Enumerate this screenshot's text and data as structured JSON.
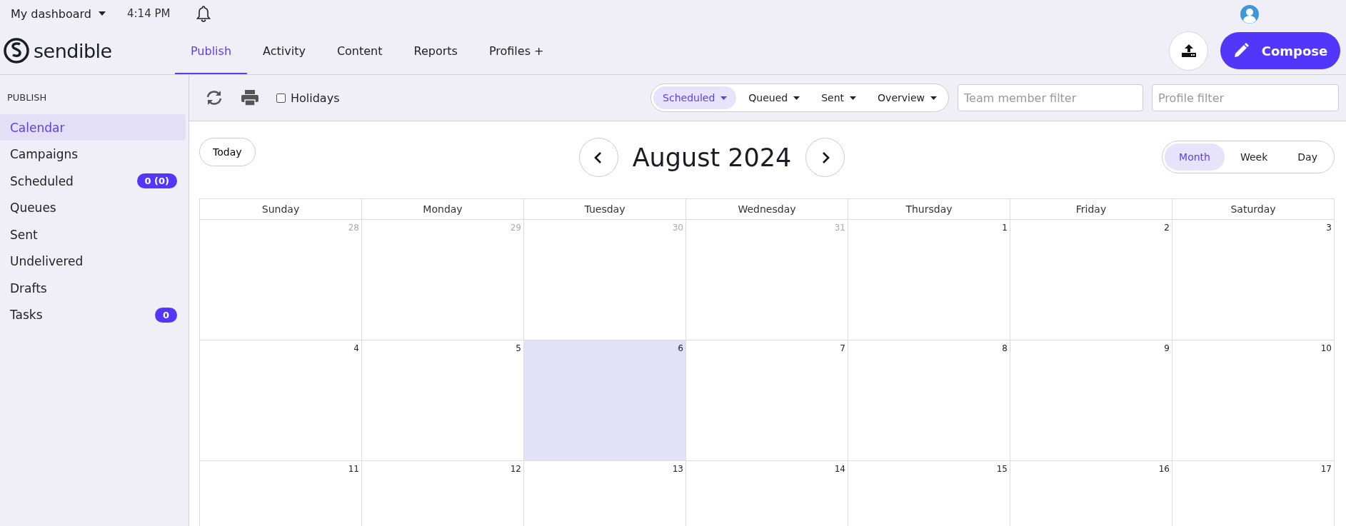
{
  "top_bar": {
    "dashboard": "My dashboard",
    "time": "4:14 PM"
  },
  "brand": "sendible",
  "nav_tabs": [
    {
      "label": "Publish",
      "selected": true
    },
    {
      "label": "Activity",
      "selected": false
    },
    {
      "label": "Content",
      "selected": false
    },
    {
      "label": "Reports",
      "selected": false
    },
    {
      "label": "Profiles +",
      "selected": false
    }
  ],
  "compose_button": "Compose",
  "sidebar": {
    "heading": "PUBLISH",
    "items": [
      {
        "label": "Calendar",
        "selected": true
      },
      {
        "label": "Campaigns",
        "selected": false
      },
      {
        "label": "Scheduled",
        "selected": false,
        "badge": "0 (0)"
      },
      {
        "label": "Queues",
        "selected": false
      },
      {
        "label": "Sent",
        "selected": false
      },
      {
        "label": "Undelivered",
        "selected": false
      },
      {
        "label": "Drafts",
        "selected": false
      },
      {
        "label": "Tasks",
        "selected": false,
        "badge": "0"
      }
    ]
  },
  "toolbar": {
    "holidays": {
      "label": "Holidays",
      "checked": false
    },
    "filters": [
      {
        "label": "Scheduled",
        "selected": true
      },
      {
        "label": "Queued",
        "selected": false
      },
      {
        "label": "Sent",
        "selected": false
      },
      {
        "label": "Overview",
        "selected": false
      }
    ],
    "team_filter": {
      "placeholder": "Team member filter"
    },
    "profile_filter": {
      "placeholder": "Profile filter"
    }
  },
  "calendar": {
    "today_button": "Today",
    "title": "August 2024",
    "views": [
      {
        "label": "Month",
        "selected": true
      },
      {
        "label": "Week",
        "selected": false
      },
      {
        "label": "Day",
        "selected": false
      }
    ],
    "weekdays": [
      "Sunday",
      "Monday",
      "Tuesday",
      "Wednesday",
      "Thursday",
      "Friday",
      "Saturday"
    ],
    "weeks": [
      [
        {
          "day": "28",
          "outside": true,
          "today": false
        },
        {
          "day": "29",
          "outside": true,
          "today": false
        },
        {
          "day": "30",
          "outside": true,
          "today": false
        },
        {
          "day": "31",
          "outside": true,
          "today": false
        },
        {
          "day": "1",
          "outside": false,
          "today": false
        },
        {
          "day": "2",
          "outside": false,
          "today": false
        },
        {
          "day": "3",
          "outside": false,
          "today": false
        }
      ],
      [
        {
          "day": "4",
          "outside": false,
          "today": false
        },
        {
          "day": "5",
          "outside": false,
          "today": false
        },
        {
          "day": "6",
          "outside": false,
          "today": true
        },
        {
          "day": "7",
          "outside": false,
          "today": false
        },
        {
          "day": "8",
          "outside": false,
          "today": false
        },
        {
          "day": "9",
          "outside": false,
          "today": false
        },
        {
          "day": "10",
          "outside": false,
          "today": false
        }
      ],
      [
        {
          "day": "11",
          "outside": false,
          "today": false
        },
        {
          "day": "12",
          "outside": false,
          "today": false
        },
        {
          "day": "13",
          "outside": false,
          "today": false
        },
        {
          "day": "14",
          "outside": false,
          "today": false
        },
        {
          "day": "15",
          "outside": false,
          "today": false
        },
        {
          "day": "16",
          "outside": false,
          "today": false
        },
        {
          "day": "17",
          "outside": false,
          "today": false
        }
      ]
    ]
  }
}
